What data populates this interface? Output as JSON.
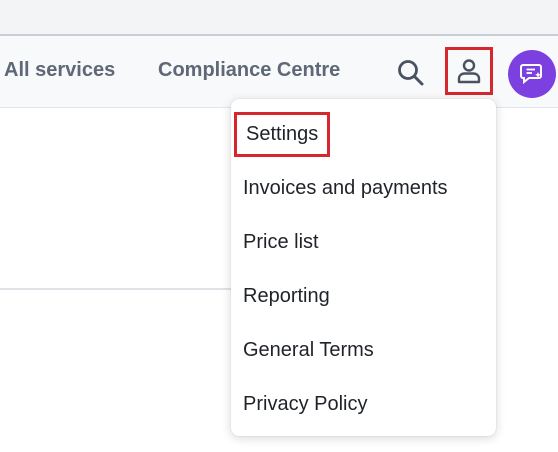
{
  "header": {
    "nav": [
      {
        "label": "All services"
      },
      {
        "label": "Compliance Centre"
      }
    ],
    "icons": {
      "search": "search-icon",
      "account": "user-account-icon",
      "chat": "chat-sparkle-icon"
    }
  },
  "account_menu": {
    "items": [
      {
        "label": "Settings",
        "highlighted": true
      },
      {
        "label": "Invoices and payments"
      },
      {
        "label": "Price list"
      },
      {
        "label": "Reporting"
      },
      {
        "label": "General Terms"
      },
      {
        "label": "Privacy Policy"
      }
    ]
  },
  "colors": {
    "highlight_outline": "#d6262e",
    "chat_button": "#7c3fe0",
    "nav_text": "#5f6876",
    "menu_text": "#1f2329"
  }
}
